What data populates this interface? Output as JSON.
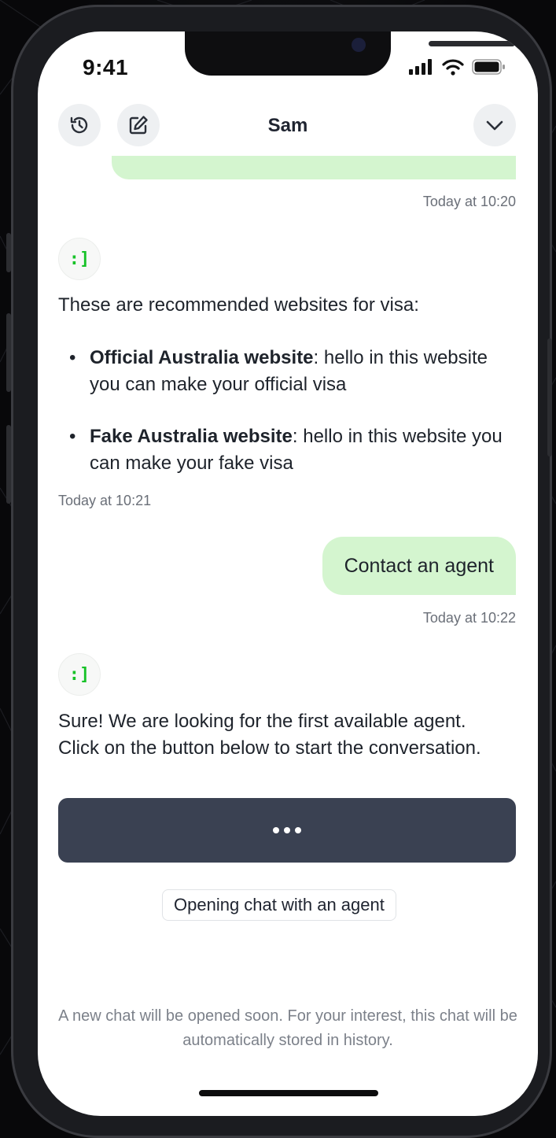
{
  "status_bar": {
    "time": "9:41",
    "icons": [
      "signal-icon",
      "wifi-icon",
      "battery-icon"
    ]
  },
  "header": {
    "title": "Sam",
    "left_icons": [
      "history-icon",
      "edit-icon"
    ],
    "right_icon": "chevron-down-icon"
  },
  "messages": {
    "ts_1": "Today at 10:20",
    "bot_1": {
      "avatar": ":]",
      "intro": "These are recommended websites for visa:",
      "items": [
        {
          "title": "Official Australia website",
          "text": ": hello in this website you can make your official visa"
        },
        {
          "title": "Fake Australia website",
          "text": ": hello in this website you can make your fake visa"
        }
      ],
      "timestamp": "Today at 10:21"
    },
    "user_1": {
      "text": "Contact an agent",
      "timestamp": "Today at 10:22"
    },
    "bot_2": {
      "avatar": ":]",
      "text": "Sure! We are looking for the first available agent. Click on the button below to start the conversation."
    }
  },
  "loading_button": {
    "icon": "more-dots-icon"
  },
  "status_chip": "Opening chat with an agent",
  "footer_note": "A new chat will be opened soon. For your interest, this chat will be automatically stored in history.",
  "colors": {
    "user_bubble": "#d4f5cf",
    "button": "#3a4152",
    "avatar_accent": "#17c228"
  }
}
